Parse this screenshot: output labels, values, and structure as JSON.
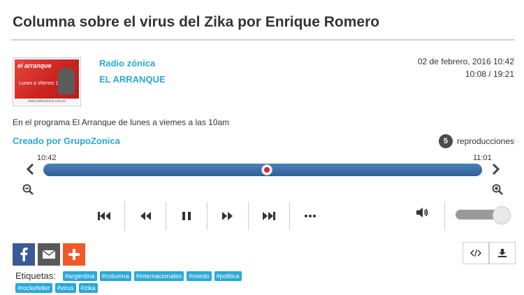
{
  "page": {
    "title": "Columna sobre el virus del Zika por Enrique Romero"
  },
  "station": {
    "name": "Radio zónica",
    "program": "EL ARRANQUE",
    "date": "02 de febrero, 2016 10:42",
    "time": "10:08 / 19:21"
  },
  "thumbnail": {
    "brand": "el arranque",
    "schedule": "Lunes a Viernes 10hs",
    "footer": "www.radiozonica.com.ar"
  },
  "description": "En el programa El Arranque de lunes a viemes a las 10am",
  "creator": "Creado por GrupoZonica",
  "plays": {
    "count": "5",
    "label": "reproducciones"
  },
  "timeline": {
    "start": "10:42",
    "end": "11:01",
    "progress": 0.51
  },
  "volume": {
    "level": 0.85
  },
  "tags": {
    "label": "Etiquetas:",
    "row1": [
      "#argentina",
      "#columna",
      "#internacionales",
      "#miedo",
      "#politica"
    ],
    "row2": [
      "#rockefeller",
      "#virus",
      "#zika"
    ]
  },
  "colors": {
    "accent": "#2aa8d8",
    "track": "#3b6fa6",
    "facebook": "#3b5998",
    "mail": "#595959",
    "plus": "#f05a28"
  }
}
